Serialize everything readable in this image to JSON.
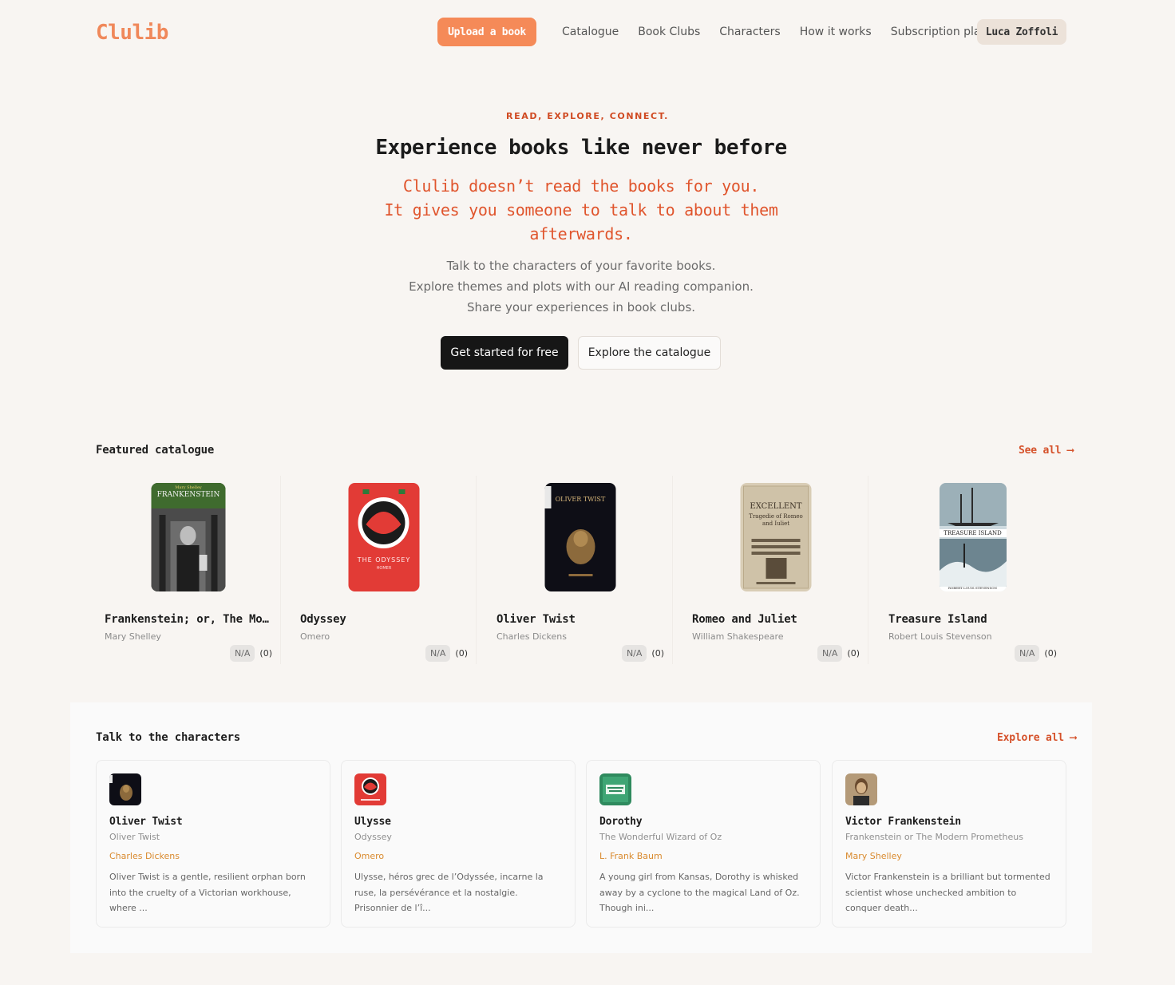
{
  "nav": {
    "logo": "Clulib",
    "upload_label": "Upload a book",
    "links": [
      "Catalogue",
      "Book Clubs",
      "Characters",
      "How it works",
      "Subscription plans"
    ],
    "user_name": "Luca Zoffoli"
  },
  "hero": {
    "eyebrow": "READ, EXPLORE, CONNECT.",
    "headline": "Experience books like never before",
    "tagline_1": "Clulib doesn’t read the books for you.",
    "tagline_2": "It gives you someone to talk to about them afterwards.",
    "sub_1": "Talk to the characters of your favorite books.",
    "sub_2": "Explore themes and plots with our AI reading companion.",
    "sub_3": "Share your experiences in book clubs.",
    "cta_primary": "Get started for free",
    "cta_secondary": "Explore the catalogue"
  },
  "featured": {
    "title": "Featured catalogue",
    "see_all": "See all ⟶",
    "books": [
      {
        "title": "Frankenstein; or, The Modern Prometheus",
        "author": "Mary Shelley",
        "rating": "N/A",
        "count": "(0)",
        "cover_text": "FRANKENSTEIN",
        "cover_top": "Mary Shelley"
      },
      {
        "title": "Odyssey",
        "author": "Omero",
        "rating": "N/A",
        "count": "(0)",
        "cover_text": "THE ODYSSEY",
        "cover_top": "HOMER"
      },
      {
        "title": "Oliver Twist",
        "author": "Charles Dickens",
        "rating": "N/A",
        "count": "(0)",
        "cover_text": "OLIVER TWIST",
        "cover_top": ""
      },
      {
        "title": "Romeo and Juliet",
        "author": "William Shakespeare",
        "rating": "N/A",
        "count": "(0)",
        "cover_text": "EXCELLENT",
        "cover_top": "Tragedie of Romeo and Iuliet"
      },
      {
        "title": "Treasure Island",
        "author": "Robert Louis Stevenson",
        "rating": "N/A",
        "count": "(0)",
        "cover_text": "TREASURE ISLAND",
        "cover_top": "ROBERT LOUIS STEVENSON"
      }
    ]
  },
  "characters": {
    "title": "Talk to the characters",
    "explore_all": "Explore all ⟶",
    "items": [
      {
        "name": "Oliver Twist",
        "book": "Oliver Twist",
        "author": "Charles Dickens",
        "desc": "Oliver Twist is a gentle, resilient orphan born into the cruelty of a Victorian workhouse, where ..."
      },
      {
        "name": "Ulysse",
        "book": "Odyssey",
        "author": "Omero",
        "desc": "Ulysse, héros grec de l’Odyssée, incarne la ruse, la persévérance et la nostalgie. Prisonnier de l’î..."
      },
      {
        "name": "Dorothy",
        "book": "The Wonderful Wizard of Oz",
        "author": "L. Frank Baum",
        "desc": "A young girl from Kansas, Dorothy is whisked away by a cyclone to the magical Land of Oz. Though ini..."
      },
      {
        "name": "Victor Frankenstein",
        "book": "Frankenstein or The Modern Prometheus",
        "author": "Mary Shelley",
        "desc": "Victor Frankenstein is a brilliant but tormented scientist whose unchecked ambition to conquer death..."
      }
    ]
  },
  "colors": {
    "accent": "#f58a58",
    "accent_text": "#d5512a",
    "background": "#f8f5f2"
  }
}
